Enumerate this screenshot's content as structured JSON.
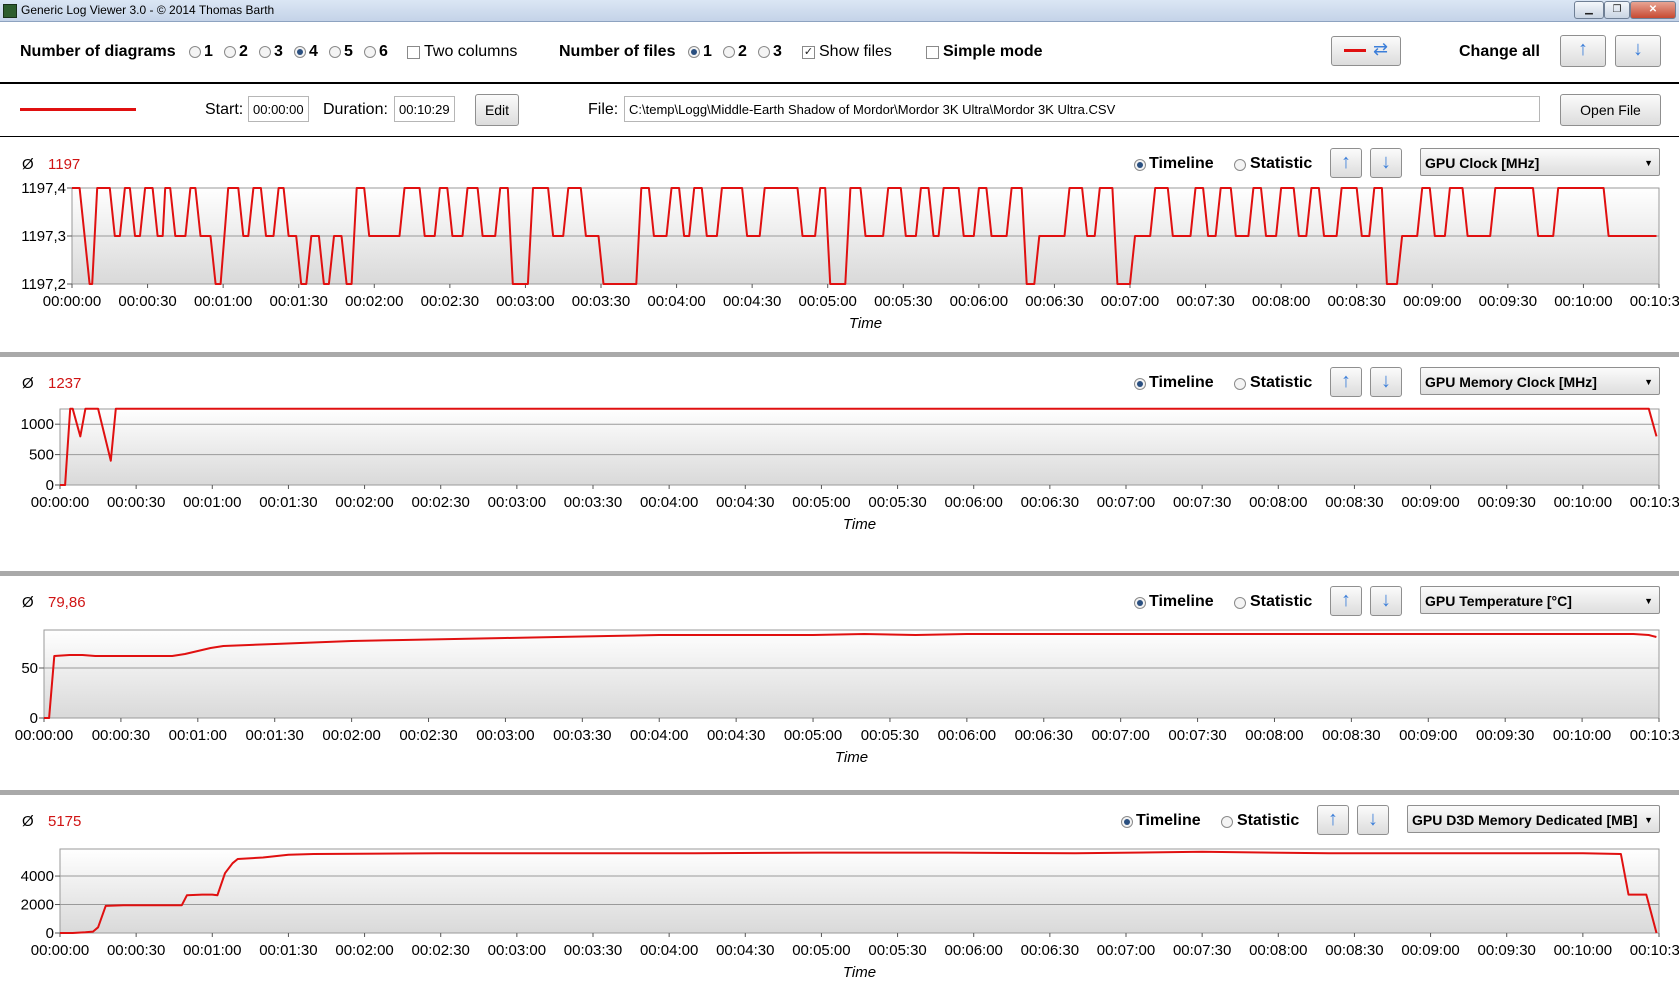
{
  "window": {
    "title": "Generic Log Viewer 3.0 - © 2014 Thomas Barth"
  },
  "toolbar": {
    "num_diagrams_label": "Number of diagrams",
    "diagram_options": [
      "1",
      "2",
      "3",
      "4",
      "5",
      "6"
    ],
    "diagram_selected": "4",
    "two_columns_label": "Two columns",
    "two_columns_checked": false,
    "num_files_label": "Number of files",
    "file_options": [
      "1",
      "2",
      "3"
    ],
    "file_selected": "1",
    "show_files_label": "Show files",
    "show_files_checked": true,
    "simple_mode_label": "Simple mode",
    "simple_mode_checked": false,
    "change_all_label": "Change all"
  },
  "file_row": {
    "start_label": "Start:",
    "start_value": "00:00:00",
    "duration_label": "Duration:",
    "duration_value": "00:10:29",
    "edit_label": "Edit",
    "file_label": "File:",
    "file_path": "C:\\temp\\Logg\\Middle-Earth Shadow of Mordor\\Mordor 3K Ultra\\Mordor 3K Ultra.CSV",
    "open_file_label": "Open File",
    "line_color": "#e01010"
  },
  "common": {
    "avg_symbol": "Ø",
    "timeline_label": "Timeline",
    "statistic_label": "Statistic",
    "mode_selected": "Timeline",
    "x_label": "Time",
    "x_ticks": [
      "00:00:00",
      "00:00:30",
      "00:01:00",
      "00:01:30",
      "00:02:00",
      "00:02:30",
      "00:03:00",
      "00:03:30",
      "00:04:00",
      "00:04:30",
      "00:05:00",
      "00:05:30",
      "00:06:00",
      "00:06:30",
      "00:07:00",
      "00:07:30",
      "00:08:00",
      "00:08:30",
      "00:09:00",
      "00:09:30",
      "00:10:00",
      "00:10:30"
    ]
  },
  "chart_data": [
    {
      "type": "line",
      "metric": "GPU Clock [MHz]",
      "average": "1197",
      "xlabel": "Time",
      "ylim": [
        1197.2,
        1197.4
      ],
      "yticks": [
        1197.2,
        1197.3,
        1197.4
      ],
      "ytick_labels": [
        "1197,2",
        "1197,3",
        "1197,4"
      ],
      "x": [
        0,
        3,
        5,
        7,
        8,
        10,
        15,
        17,
        19,
        21,
        23,
        25,
        27,
        29,
        32,
        34,
        36,
        37,
        39,
        41,
        45,
        47,
        49,
        51,
        55,
        57,
        59,
        62,
        66,
        68,
        70,
        72,
        75,
        77,
        80,
        82,
        84,
        86,
        89,
        91,
        93,
        95,
        98,
        100,
        102,
        104,
        107,
        109,
        111,
        113,
        116,
        118,
        121,
        123,
        130,
        132,
        138,
        140,
        144,
        146,
        149,
        151,
        155,
        157,
        161,
        163,
        168,
        170,
        173,
        175,
        181,
        183,
        189,
        191,
        195,
        197,
        202,
        204,
        209,
        211,
        216,
        218,
        224,
        226,
        229,
        231,
        236,
        238,
        241,
        243,
        245,
        247,
        250,
        252,
        256,
        258,
        266,
        268,
        273,
        275,
        288,
        290,
        295,
        297,
        299,
        301,
        307,
        309,
        313,
        315,
        322,
        324,
        329,
        331,
        335,
        337,
        340,
        342,
        344,
        346,
        352,
        354,
        358,
        360,
        363,
        365,
        371,
        373,
        377,
        379,
        382,
        384,
        394,
        396,
        401,
        403,
        406,
        408,
        413,
        415,
        420,
        422,
        428,
        430,
        435,
        437,
        444,
        446,
        449,
        451,
        454,
        456,
        460,
        462,
        467,
        469,
        472,
        474,
        478,
        480,
        485,
        487,
        490,
        492,
        495,
        497,
        502,
        504,
        510,
        512,
        515,
        517,
        520,
        522,
        526,
        528,
        534,
        536,
        539,
        541,
        545,
        547,
        552,
        554,
        563,
        565,
        580,
        582,
        588,
        590,
        608,
        610,
        629
      ],
      "values": [
        1197.4,
        1197.4,
        1197.3,
        1197.2,
        1197.2,
        1197.4,
        1197.4,
        1197.3,
        1197.3,
        1197.4,
        1197.4,
        1197.3,
        1197.3,
        1197.4,
        1197.4,
        1197.3,
        1197.3,
        1197.4,
        1197.4,
        1197.3,
        1197.3,
        1197.4,
        1197.4,
        1197.3,
        1197.3,
        1197.2,
        1197.2,
        1197.4,
        1197.4,
        1197.3,
        1197.3,
        1197.4,
        1197.4,
        1197.3,
        1197.3,
        1197.4,
        1197.4,
        1197.3,
        1197.3,
        1197.2,
        1197.2,
        1197.3,
        1197.3,
        1197.2,
        1197.2,
        1197.3,
        1197.3,
        1197.2,
        1197.2,
        1197.4,
        1197.4,
        1197.3,
        1197.3,
        1197.3,
        1197.3,
        1197.4,
        1197.4,
        1197.3,
        1197.3,
        1197.4,
        1197.4,
        1197.3,
        1197.3,
        1197.4,
        1197.4,
        1197.3,
        1197.3,
        1197.4,
        1197.4,
        1197.2,
        1197.2,
        1197.4,
        1197.4,
        1197.3,
        1197.3,
        1197.4,
        1197.4,
        1197.3,
        1197.3,
        1197.2,
        1197.2,
        1197.2,
        1197.2,
        1197.4,
        1197.4,
        1197.3,
        1197.3,
        1197.4,
        1197.4,
        1197.3,
        1197.3,
        1197.4,
        1197.4,
        1197.3,
        1197.3,
        1197.4,
        1197.4,
        1197.3,
        1197.3,
        1197.4,
        1197.4,
        1197.3,
        1197.3,
        1197.4,
        1197.4,
        1197.2,
        1197.2,
        1197.4,
        1197.4,
        1197.3,
        1197.3,
        1197.4,
        1197.4,
        1197.3,
        1197.3,
        1197.4,
        1197.4,
        1197.3,
        1197.3,
        1197.4,
        1197.4,
        1197.3,
        1197.3,
        1197.4,
        1197.4,
        1197.3,
        1197.3,
        1197.4,
        1197.4,
        1197.2,
        1197.2,
        1197.3,
        1197.3,
        1197.4,
        1197.4,
        1197.3,
        1197.3,
        1197.4,
        1197.4,
        1197.2,
        1197.2,
        1197.3,
        1197.3,
        1197.4,
        1197.4,
        1197.3,
        1197.3,
        1197.4,
        1197.4,
        1197.3,
        1197.3,
        1197.4,
        1197.4,
        1197.3,
        1197.3,
        1197.4,
        1197.4,
        1197.3,
        1197.3,
        1197.4,
        1197.4,
        1197.3,
        1197.3,
        1197.4,
        1197.4,
        1197.3,
        1197.3,
        1197.4,
        1197.4,
        1197.3,
        1197.3,
        1197.4,
        1197.4,
        1197.2,
        1197.2,
        1197.3,
        1197.3,
        1197.4,
        1197.4,
        1197.3,
        1197.3,
        1197.4,
        1197.4,
        1197.3,
        1197.3,
        1197.4,
        1197.4,
        1197.3,
        1197.3,
        1197.4,
        1197.4,
        1197.3,
        1197.3,
        1197.4,
        1197.4,
        1197.2,
        1197.2,
        1197.3,
        1197.3,
        1197.4,
        1197.4,
        1197.3,
        1197.3,
        1197.4,
        1197.4
      ]
    },
    {
      "type": "line",
      "metric": "GPU Memory Clock [MHz]",
      "average": "1237",
      "xlabel": "Time",
      "ylim": [
        0,
        1250
      ],
      "yticks": [
        0,
        500,
        1000
      ],
      "ytick_labels": [
        "0",
        "500",
        "1000"
      ],
      "x": [
        0,
        2,
        4,
        5,
        8,
        10,
        13,
        15,
        20,
        22,
        24,
        626,
        629
      ],
      "values": [
        0,
        0,
        1253,
        1253,
        800,
        1253,
        1253,
        1253,
        400,
        1253,
        1253,
        1253,
        800
      ]
    },
    {
      "type": "line",
      "metric": "GPU Temperature [°C]",
      "average": "79,86",
      "xlabel": "Time",
      "ylim": [
        0,
        88
      ],
      "yticks": [
        0,
        50
      ],
      "ytick_labels": [
        "0",
        "50"
      ],
      "x": [
        0,
        2,
        4,
        10,
        15,
        20,
        30,
        40,
        48,
        50,
        55,
        60,
        65,
        70,
        80,
        90,
        100,
        120,
        140,
        160,
        180,
        200,
        220,
        240,
        260,
        280,
        300,
        320,
        340,
        360,
        400,
        450,
        500,
        550,
        600,
        620,
        626,
        629
      ],
      "values": [
        0,
        0,
        62,
        63,
        63,
        62,
        62,
        62,
        62,
        62,
        64,
        67,
        70,
        72,
        73,
        74,
        75,
        77,
        78,
        79,
        80,
        81,
        82,
        83,
        83,
        83,
        83,
        84,
        83,
        84,
        84,
        84,
        84,
        84,
        84,
        84,
        83,
        81
      ]
    },
    {
      "type": "line",
      "metric": "GPU D3D Memory Dedicated [MB]",
      "average": "5175",
      "xlabel": "Time",
      "ylim": [
        0,
        5900
      ],
      "yticks": [
        0,
        2000,
        4000
      ],
      "ytick_labels": [
        "0",
        "2000",
        "4000"
      ],
      "x": [
        0,
        5,
        10,
        13,
        15,
        18,
        25,
        30,
        40,
        48,
        50,
        56,
        60,
        62,
        65,
        68,
        70,
        80,
        90,
        100,
        150,
        200,
        250,
        300,
        350,
        400,
        450,
        500,
        550,
        600,
        615,
        618,
        620,
        625,
        629
      ],
      "values": [
        0,
        0,
        50,
        100,
        400,
        1900,
        1950,
        1950,
        1950,
        1950,
        2650,
        2700,
        2700,
        2650,
        4200,
        4900,
        5200,
        5300,
        5500,
        5550,
        5600,
        5600,
        5600,
        5650,
        5650,
        5600,
        5700,
        5600,
        5600,
        5600,
        5550,
        2700,
        2700,
        2700,
        0
      ]
    }
  ]
}
